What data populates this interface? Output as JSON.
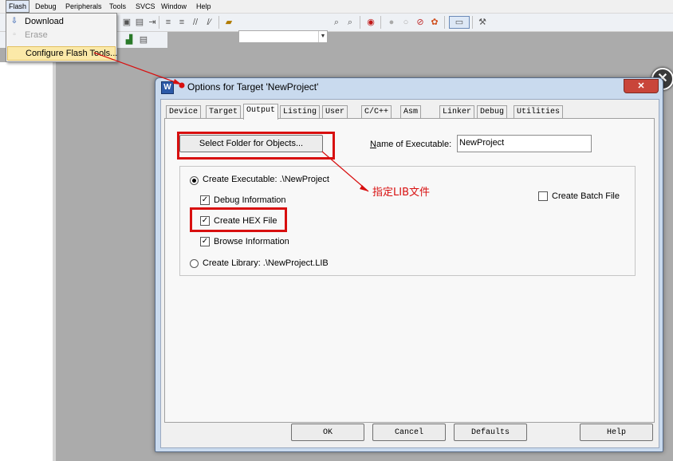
{
  "menubar": {
    "items": [
      "Flash",
      "Debug",
      "Peripherals",
      "Tools",
      "SVCS",
      "Window",
      "Help"
    ]
  },
  "flash_menu": {
    "items": [
      {
        "label": "Download",
        "icon": "download-icon",
        "enabled": true
      },
      {
        "label": "Erase",
        "icon": "erase-icon",
        "enabled": false
      },
      {
        "label": "Configure Flash Tools...",
        "icon": "none",
        "enabled": true,
        "highlighted": true
      }
    ]
  },
  "dialog": {
    "title": "Options for Target 'NewProject'",
    "icon_letter": "W",
    "tabs": [
      "Device",
      "Target",
      "Output",
      "Listing",
      "User",
      "C/C++",
      "Asm",
      "Linker",
      "Debug",
      "Utilities"
    ],
    "active_tab": "Output",
    "output": {
      "select_folder_button": "Select Folder for Objects...",
      "name_of_executable_label": "Name of Executable:",
      "name_of_executable_value": "NewProject",
      "create_executable_label": "Create Executable:  .\\NewProject",
      "create_executable_checked": true,
      "debug_information_label": "Debug Information",
      "debug_information_checked": true,
      "create_hex_label": "Create HEX File",
      "create_hex_checked": true,
      "browse_information_label": "Browse Information",
      "browse_information_checked": true,
      "create_library_label": "Create Library:  .\\NewProject.LIB",
      "create_library_checked": false,
      "create_batch_label": "Create Batch File",
      "create_batch_checked": false
    },
    "buttons": {
      "ok": "OK",
      "cancel": "Cancel",
      "defaults": "Defaults",
      "help": "Help"
    }
  },
  "annotation": {
    "text": "指定LIB文件",
    "color": "#d81010"
  },
  "colors": {
    "accent_red": "#d80f0f",
    "dialog_frame": "#c9daee",
    "close_button": "#c9453a"
  }
}
